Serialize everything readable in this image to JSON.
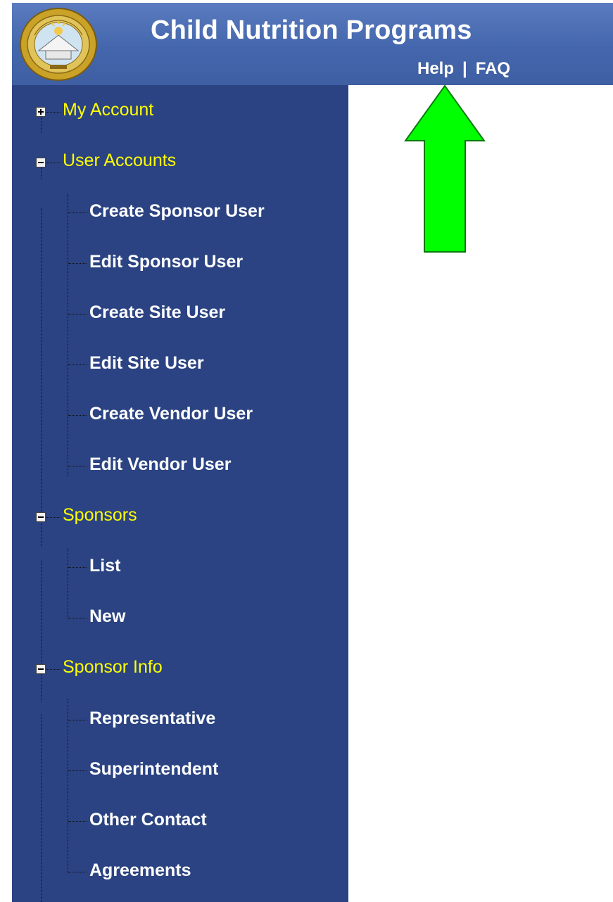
{
  "header": {
    "title": "Child Nutrition Programs",
    "help_link": "Help",
    "separator": "|",
    "faq_link": "FAQ",
    "seal_text": "ALABAMA"
  },
  "nav": {
    "my_account": "My Account",
    "user_accounts": {
      "label": "User Accounts",
      "items": [
        "Create Sponsor User",
        "Edit Sponsor User",
        "Create Site User",
        "Edit Site User",
        "Create Vendor User",
        "Edit Vendor User"
      ]
    },
    "sponsors": {
      "label": "Sponsors",
      "items": [
        "List",
        "New"
      ]
    },
    "sponsor_info": {
      "label": "Sponsor Info",
      "items": [
        "Representative",
        "Superintendent",
        "Other Contact",
        "Agreements"
      ]
    }
  },
  "colors": {
    "header_bg": "#4466ac",
    "sidebar_bg": "#2b4382",
    "category_text": "#ffff00",
    "item_text": "#ffffff",
    "annotation_arrow": "#00ff00"
  }
}
